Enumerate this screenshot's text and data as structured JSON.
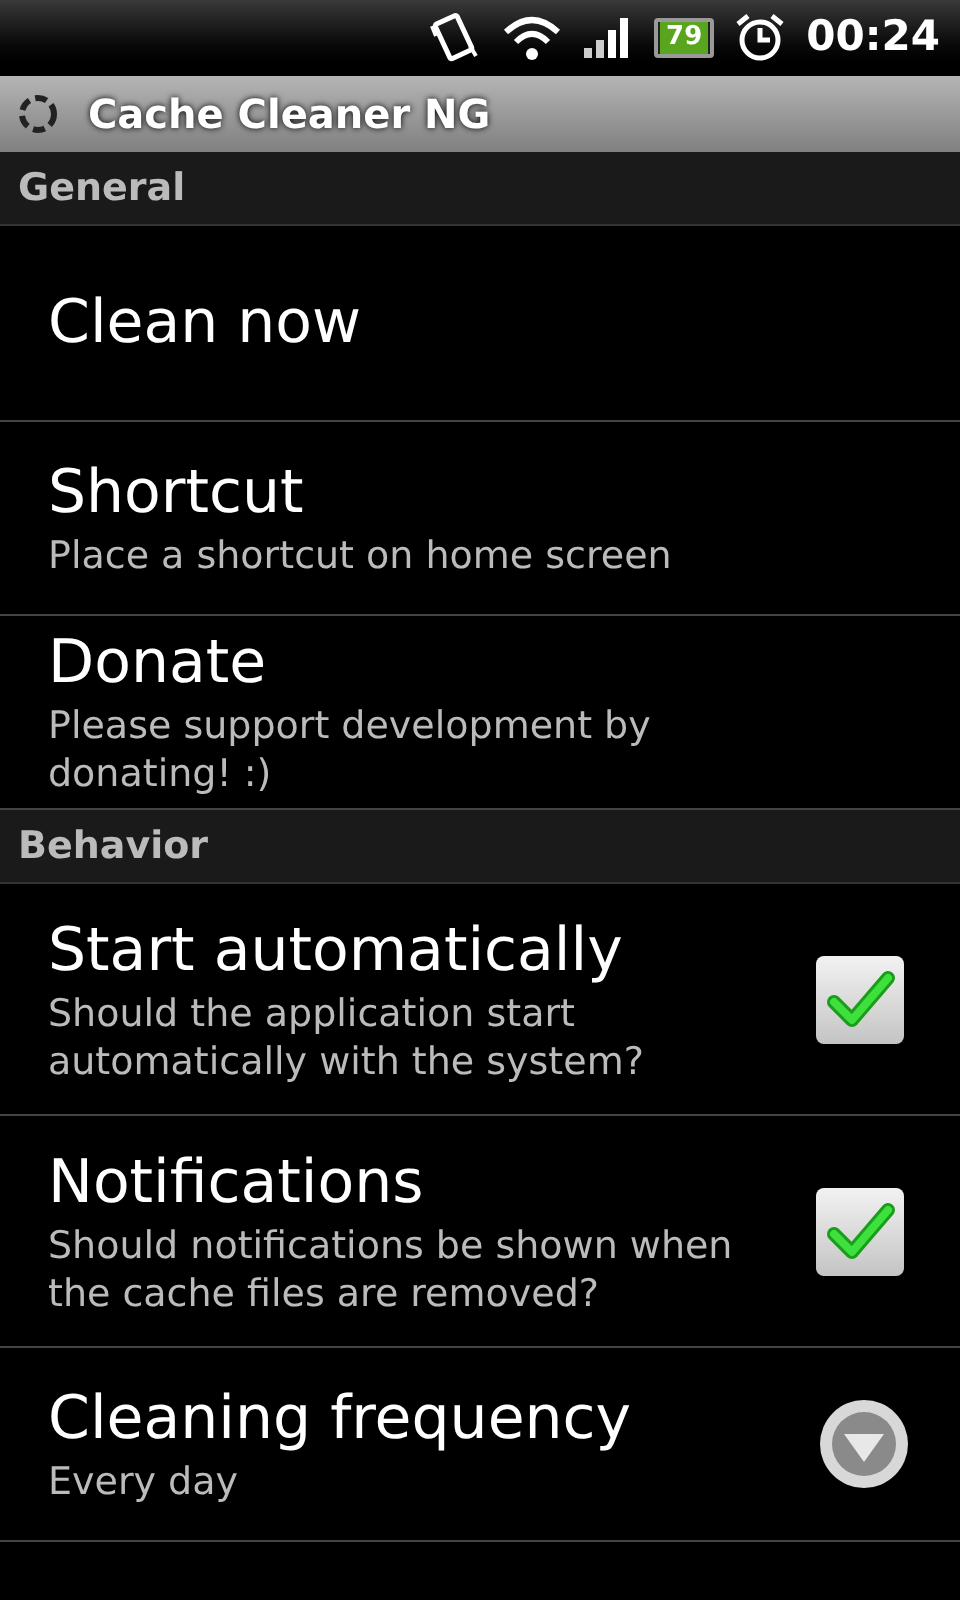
{
  "status_bar": {
    "battery": "79",
    "time": "00:24"
  },
  "title_bar": {
    "title": "Cache Cleaner NG"
  },
  "sections": [
    {
      "header": "General",
      "items": [
        {
          "kind": "plain",
          "title": "Clean now"
        },
        {
          "kind": "plain",
          "title": "Shortcut",
          "summary": "Place a shortcut on home screen"
        },
        {
          "kind": "plain",
          "title": "Donate",
          "summary": "Please support development by donating! :)"
        }
      ]
    },
    {
      "header": "Behavior",
      "items": [
        {
          "kind": "checkbox",
          "title": "Start automatically",
          "summary": "Should the application start automatically with the system?",
          "checked": true
        },
        {
          "kind": "checkbox",
          "title": "Notifications",
          "summary": "Should notifications be shown when the cache files are removed?",
          "checked": true
        },
        {
          "kind": "list",
          "title": "Cleaning frequency",
          "summary": "Every day"
        }
      ]
    }
  ]
}
